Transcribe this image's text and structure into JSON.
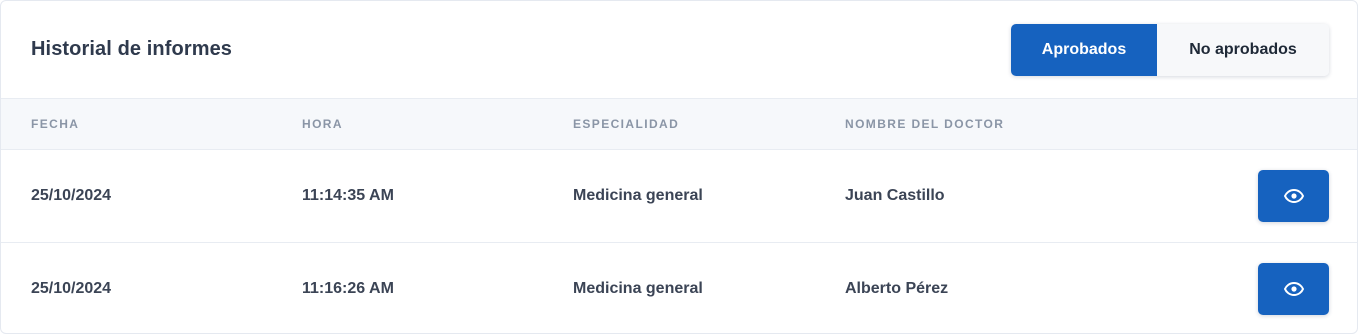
{
  "header": {
    "title": "Historial de informes",
    "toggle": {
      "approved_label": "Aprobados",
      "not_approved_label": "No aprobados",
      "selected": "Aprobados"
    }
  },
  "table": {
    "columns": [
      "FECHA",
      "HORA",
      "ESPECIALIDAD",
      "NOMBRE DEL DOCTOR"
    ],
    "rows": [
      {
        "fecha": "25/10/2024",
        "hora": "11:14:35 AM",
        "especialidad": "Medicina general",
        "doctor": "Juan Castillo",
        "action_icon": "eye-icon"
      },
      {
        "fecha": "25/10/2024",
        "hora": "11:16:26 AM",
        "especialidad": "Medicina general",
        "doctor": "Alberto Pérez",
        "action_icon": "eye-icon"
      }
    ]
  },
  "colors": {
    "primary": "#1662bf",
    "header_bg": "#f6f8fb",
    "text": "#3b4455",
    "column_header_text": "#8a95a6"
  }
}
